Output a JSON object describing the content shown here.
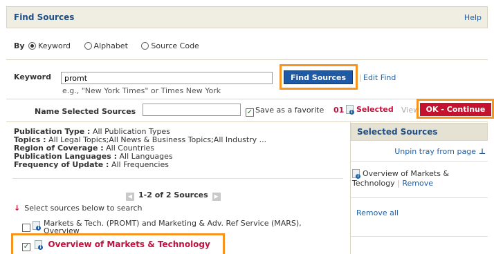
{
  "header": {
    "title": "Find Sources",
    "help": "Help"
  },
  "search_by": {
    "label": "By",
    "options": [
      {
        "label": "Keyword",
        "selected": true
      },
      {
        "label": "Alphabet",
        "selected": false
      },
      {
        "label": "Source Code",
        "selected": false
      }
    ]
  },
  "keyword": {
    "label": "Keyword",
    "value": "promt",
    "hint": "e.g., \"New York Times\" or Times New York",
    "find_button": "Find Sources",
    "separator": "|",
    "edit_find": "Edit Find"
  },
  "name_selected": {
    "label": "Name Selected Sources",
    "value": "",
    "favorite_label": "Save as a favorite",
    "favorite_checked": true,
    "selected_count": "01",
    "selected_label": "Selected",
    "view_label": "View",
    "ok_button": "OK - Continue"
  },
  "filters": [
    {
      "label": "Publication Type :",
      "value": "All Publication Types"
    },
    {
      "label": "Topics :",
      "value": "All Legal Topics;All News & Business Topics;All Industry ..."
    },
    {
      "label": "Region of Coverage :",
      "value": "All Countries"
    },
    {
      "label": "Publication Languages :",
      "value": "All Languages"
    },
    {
      "label": "Frequency of Update :",
      "value": "All Frequencies"
    }
  ],
  "pager": {
    "text": "1-2 of 2 Sources"
  },
  "select_prompt": "Select sources below to search",
  "results": [
    {
      "label": "Markets & Tech. (PROMT) and Marketing & Adv. Ref Service (MARS), Overview",
      "checked": false
    },
    {
      "label": "Overview of Markets & Technology",
      "checked": true
    }
  ],
  "selected_panel": {
    "title": "Selected Sources",
    "unpin": "Unpin tray from page",
    "item": "Overview of Markets & Technology",
    "item_sep": "|",
    "remove": "Remove",
    "remove_all": "Remove all"
  },
  "colors": {
    "accent": "#1e4f86",
    "highlight": "#f7941d",
    "ok": "#c4122f"
  }
}
